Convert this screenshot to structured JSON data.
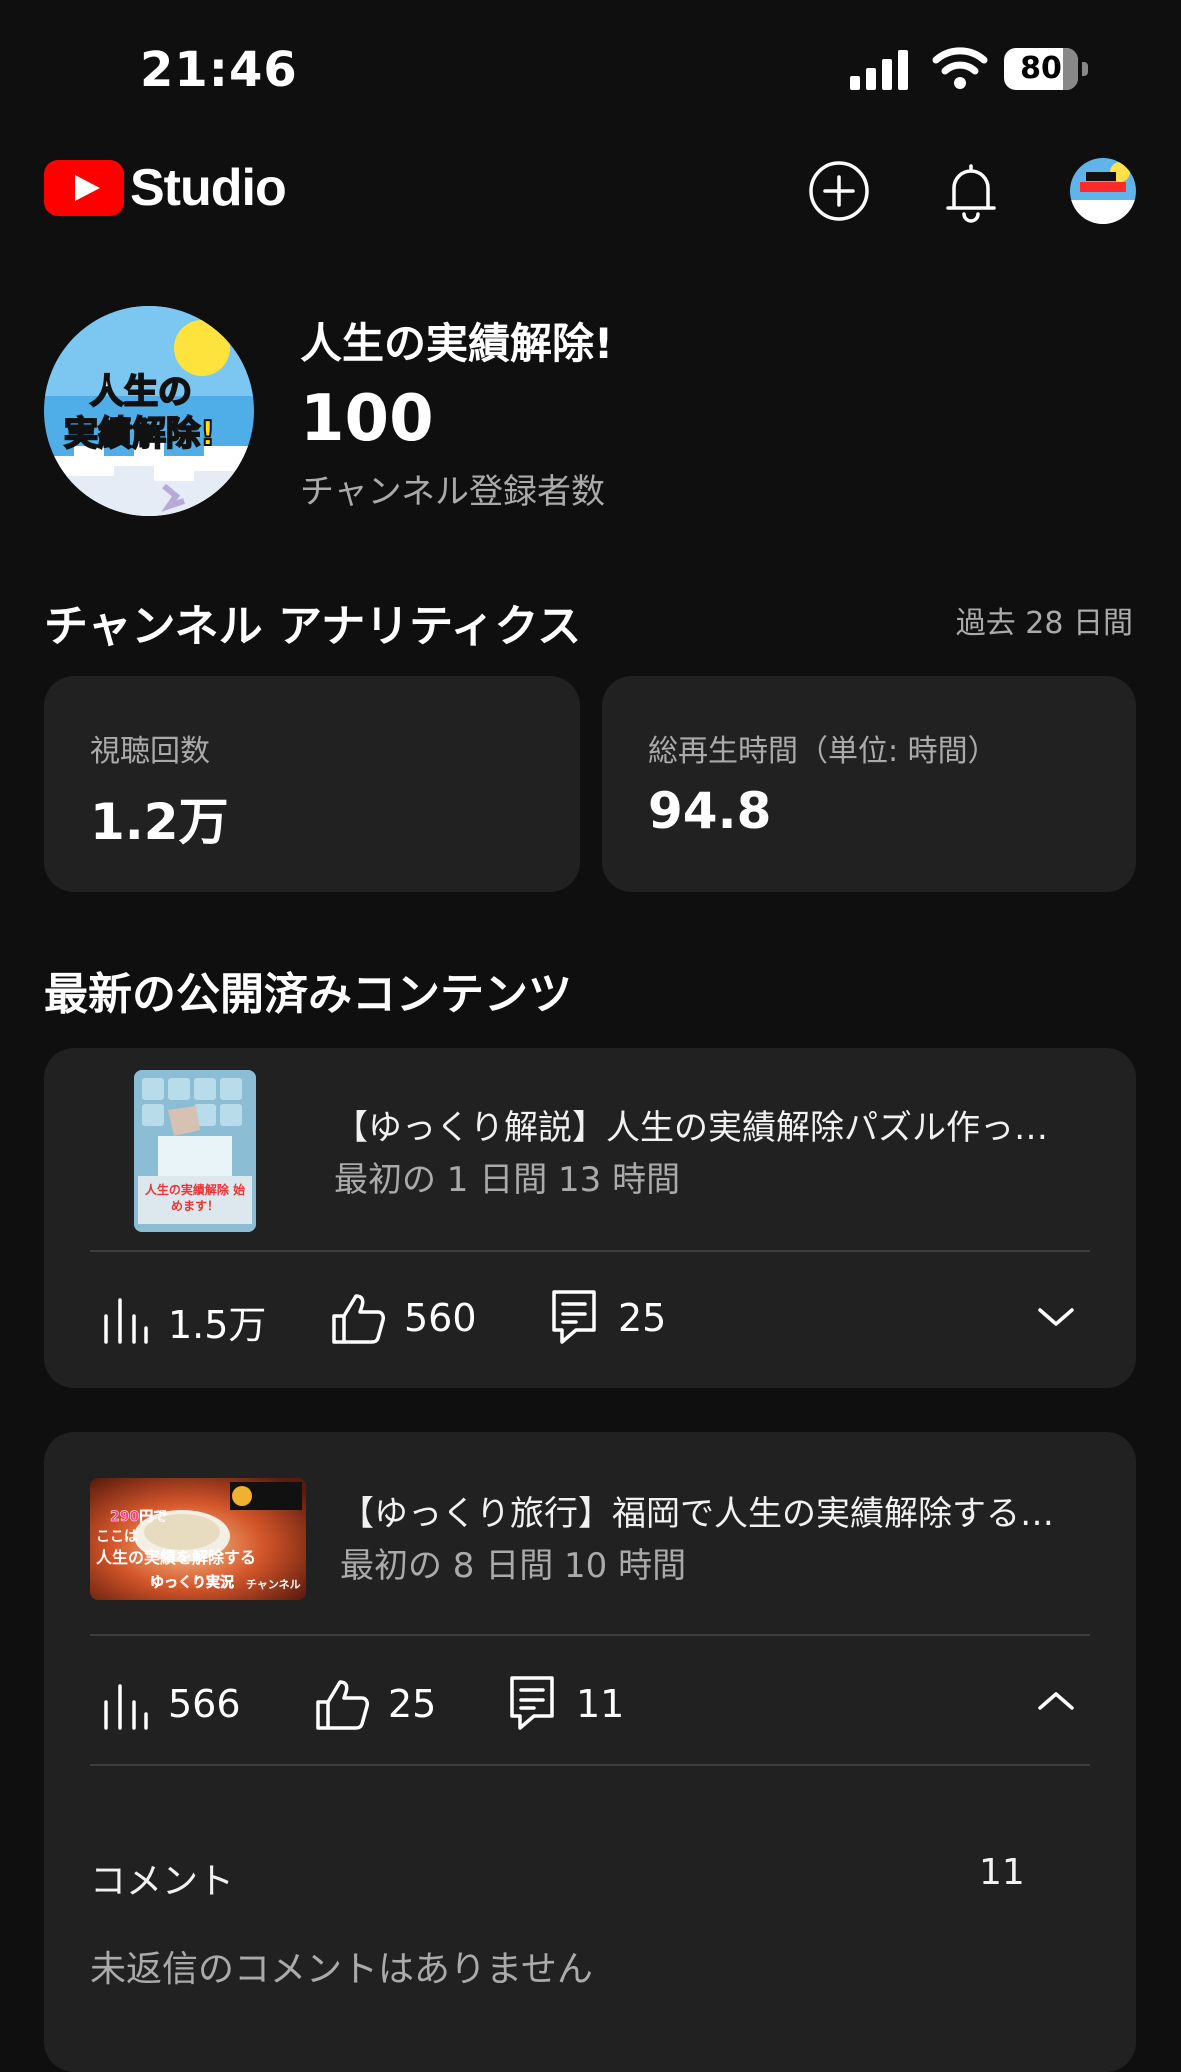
{
  "status_bar": {
    "time": "21:46",
    "battery": "80",
    "battery_level": 0.8
  },
  "header": {
    "app_name": "Studio",
    "brand_color": "#ff0000",
    "icons": [
      "create-icon",
      "bell-icon",
      "account-avatar"
    ]
  },
  "channel": {
    "name": "人生の実績解除!",
    "subscribers": "100",
    "subscribers_label": "チャンネル登録者数",
    "avatar_text_top": "人生の",
    "avatar_text_bottom": "実績解除!"
  },
  "analytics": {
    "title": "チャンネル アナリティクス",
    "period": "過去 28 日間",
    "cards": [
      {
        "label": "視聴回数",
        "value": "1.2万"
      },
      {
        "label": "総再生時間（単位: 時間）",
        "value": "94.8"
      }
    ]
  },
  "latest": {
    "title": "最新の公開済みコンテンツ",
    "videos": [
      {
        "title": "【ゆっくり解説】人生の実績解除パズル作っ…",
        "period": "最初の 1 日間 13 時間",
        "views": "1.5万",
        "likes": "560",
        "comments": "25",
        "expanded": false,
        "thumb_text": "人生の実績解除 始めます！"
      },
      {
        "title": "【ゆっくり旅行】福岡で人生の実績解除する…",
        "period": "最初の 8 日間 10 時間",
        "views": "566",
        "likes": "25",
        "comments": "11",
        "expanded": true,
        "thumb_text_price": "290円で",
        "thumb_text_line1": "ここは",
        "thumb_text_line2": "人生の実績を解除する",
        "thumb_text_line3": "ゆっくり実況",
        "thumb_text_line4": "チャンネル",
        "comment_section": {
          "label": "コメント",
          "count": "11",
          "empty_message": "未返信のコメントはありません"
        }
      }
    ]
  }
}
